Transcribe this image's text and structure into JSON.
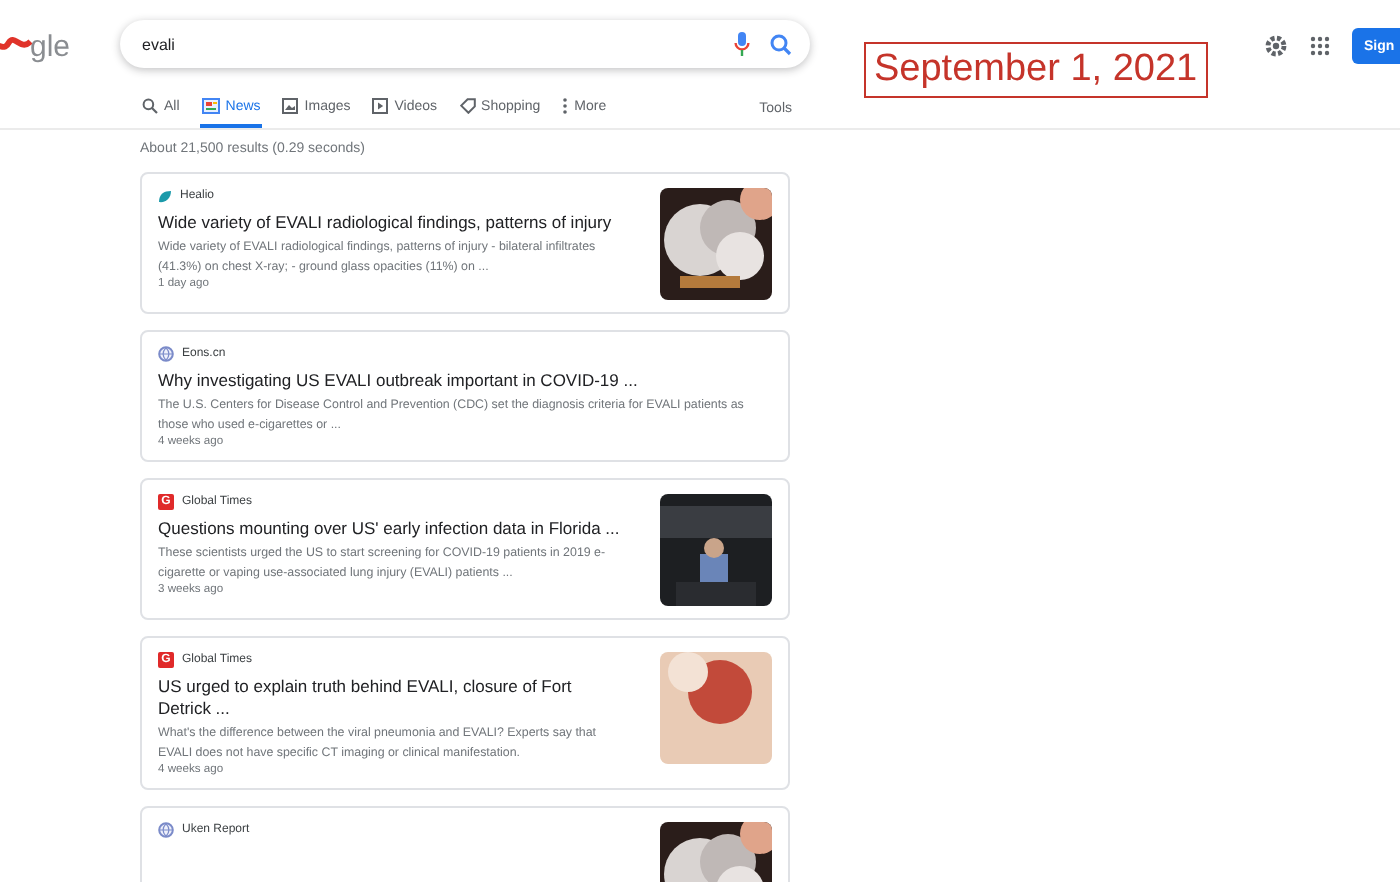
{
  "logo": {
    "text": "gle"
  },
  "search": {
    "value": "evali"
  },
  "date_stamp": "September 1, 2021",
  "sign_in_button": "Sign",
  "tabs": [
    {
      "label": "All",
      "selected": false
    },
    {
      "label": "News",
      "selected": true
    },
    {
      "label": "Images",
      "selected": false
    },
    {
      "label": "Videos",
      "selected": false
    },
    {
      "label": "Shopping",
      "selected": false
    },
    {
      "label": "More",
      "selected": false
    }
  ],
  "tools": "Tools",
  "result_stats": "About 21,500 results (0.29 seconds)",
  "results": [
    {
      "source": "Healio",
      "kind": "leaf",
      "title": "Wide variety of EVALI radiological findings, patterns of injury",
      "snippet": "Wide variety of EVALI radiological findings, patterns of injury - bilateral infiltrates (41.3%) on chest X-ray; - ground glass opacities (11%) on ...",
      "time": "1 day ago"
    },
    {
      "source": "Eons.cn",
      "kind": "globe",
      "title": "Why investigating US EVALI outbreak important in COVID-19 ...",
      "snippet": "The U.S. Centers for Disease Control and Prevention (CDC) set the diagnosis criteria for EVALI patients as those who used e-cigarettes or ...",
      "time": "4 weeks ago"
    },
    {
      "source": "Global Times",
      "kind": "letter",
      "source_letter": "G",
      "title": "Questions mounting over US' early infection data in Florida ...",
      "snippet": "These scientists urged the US to start screening for COVID-19 patients in 2019 e-cigarette or vaping use-associated lung injury (EVALI) patients ...",
      "time": "3 weeks ago"
    },
    {
      "source": "Global Times",
      "kind": "letter",
      "source_letter": "G",
      "title": "US urged to explain truth behind EVALI, closure of Fort Detrick ...",
      "snippet": "What's the difference between the viral pneumonia and EVALI? Experts say that EVALI does not have specific CT imaging or clinical manifestation.",
      "time": "4 weeks ago"
    },
    {
      "source": "Uken Report",
      "kind": "globe"
    }
  ]
}
